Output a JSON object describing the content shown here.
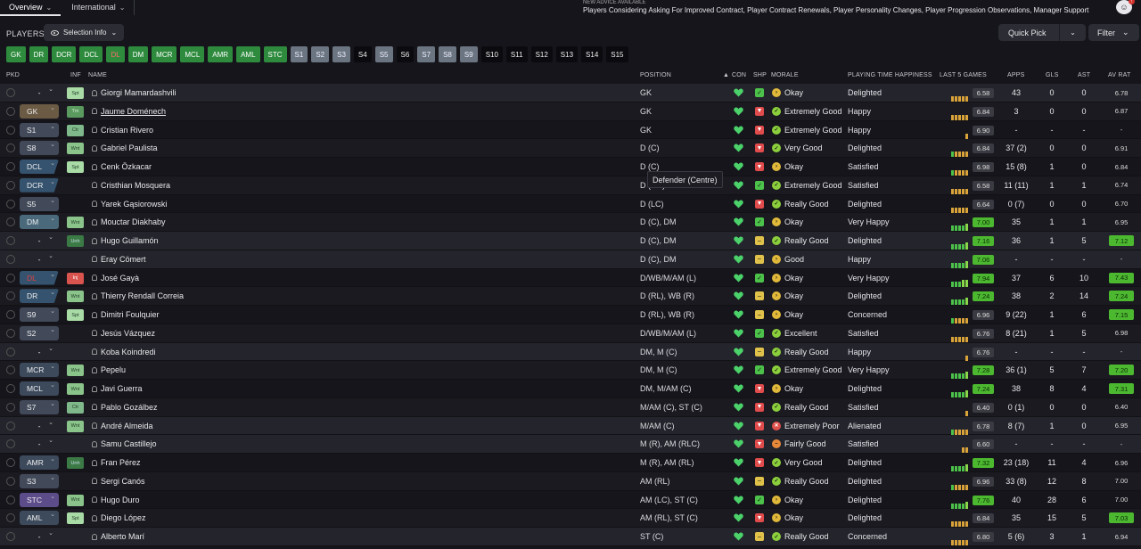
{
  "nav": {
    "tabs": [
      {
        "label": "Overview",
        "active": true
      },
      {
        "label": "International",
        "active": false
      }
    ]
  },
  "advice": {
    "heading": "NEW ADVICE AVAILABLE",
    "text": "Players Considering Asking For Improved Contract, Player Contract Renewals, Player Personality Changes, Player Progression Observations, Manager Support"
  },
  "header": {
    "title": "PLAYERS",
    "selection_info": "Selection Info",
    "quick_pick": "Quick Pick",
    "filter": "Filter"
  },
  "positions": [
    {
      "label": "GK",
      "style": "green"
    },
    {
      "label": "DR",
      "style": "green"
    },
    {
      "label": "DCR",
      "style": "green"
    },
    {
      "label": "DCL",
      "style": "green"
    },
    {
      "label": "DL",
      "style": "green red"
    },
    {
      "label": "DM",
      "style": "green"
    },
    {
      "label": "MCR",
      "style": "green"
    },
    {
      "label": "MCL",
      "style": "green"
    },
    {
      "label": "AMR",
      "style": "green"
    },
    {
      "label": "AML",
      "style": "green"
    },
    {
      "label": "STC",
      "style": "green"
    },
    {
      "label": "S1",
      "style": "grey"
    },
    {
      "label": "S2",
      "style": "grey"
    },
    {
      "label": "S3",
      "style": "grey"
    },
    {
      "label": "S4",
      "style": "black"
    },
    {
      "label": "S5",
      "style": "grey"
    },
    {
      "label": "S6",
      "style": "black"
    },
    {
      "label": "S7",
      "style": "grey"
    },
    {
      "label": "S8",
      "style": "grey"
    },
    {
      "label": "S9",
      "style": "grey"
    },
    {
      "label": "S10",
      "style": "black"
    },
    {
      "label": "S11",
      "style": "black"
    },
    {
      "label": "S12",
      "style": "black"
    },
    {
      "label": "S13",
      "style": "black"
    },
    {
      "label": "S14",
      "style": "black"
    },
    {
      "label": "S15",
      "style": "black"
    }
  ],
  "columns": {
    "pkd": "PKD",
    "inf": "INF",
    "name": "NAME",
    "position": "POSITION",
    "con": "CON",
    "shp": "SHP",
    "morale": "MORALE",
    "pth": "PLAYING TIME HAPPINESS",
    "last5": "LAST 5 GAMES",
    "apps": "APPS",
    "gls": "GLS",
    "ast": "AST",
    "avrat": "AV RAT"
  },
  "players": [
    {
      "pkd": "-",
      "pkd_type": "none",
      "inf": "Spt",
      "name": "Giorgi Mamardashvili",
      "position": "GK",
      "shp": "g",
      "morale": "Okay",
      "mood": "okay",
      "pth": "Delighted",
      "last5": [
        "o",
        "o",
        "o",
        "o",
        "o"
      ],
      "rating": "6.58",
      "apps": "43",
      "gls": "0",
      "ast": "0",
      "avrat": "6.78"
    },
    {
      "pkd": "GK",
      "pkd_type": "gk",
      "inf": "Tm",
      "name": "Jaume Doménech",
      "position": "GK",
      "shp": "r",
      "morale": "Extremely Good",
      "mood": "good",
      "pth": "Happy",
      "last5": [
        "o",
        "o",
        "o",
        "o",
        "o"
      ],
      "rating": "6.84",
      "apps": "3",
      "gls": "0",
      "ast": "0",
      "avrat": "6.87",
      "underline": true
    },
    {
      "pkd": "S1",
      "pkd_type": "sub",
      "inf": "Ctr",
      "name": "Cristian Rivero",
      "position": "GK",
      "shp": "r",
      "morale": "Extremely Good",
      "mood": "good",
      "pth": "Happy",
      "last5": [
        "o"
      ],
      "rating": "6.90",
      "apps": "-",
      "gls": "-",
      "ast": "-",
      "avrat": "-"
    },
    {
      "pkd": "S8",
      "pkd_type": "sub",
      "inf": "Wnt",
      "name": "Gabriel Paulista",
      "position": "D (C)",
      "shp": "r",
      "morale": "Very Good",
      "mood": "good",
      "pth": "Delighted",
      "last5": [
        "g",
        "o",
        "o",
        "o",
        "o"
      ],
      "rating": "6.84",
      "apps": "37 (2)",
      "gls": "0",
      "ast": "0",
      "avrat": "6.91"
    },
    {
      "pkd": "DCL",
      "pkd_type": "def",
      "inf": "Spt",
      "name": "Cenk Özkacar",
      "position": "D (C)",
      "shp": "r",
      "morale": "Okay",
      "mood": "okay",
      "pth": "Satisfied",
      "last5": [
        "g",
        "o",
        "o",
        "o",
        "o"
      ],
      "rating": "6.98",
      "apps": "15 (8)",
      "gls": "1",
      "ast": "0",
      "avrat": "6.84"
    },
    {
      "pkd": "DCR",
      "pkd_type": "def",
      "inf": "",
      "name": "Cristhian Mosquera",
      "position": "D (RC)",
      "shp": "g",
      "morale": "Extremely Good",
      "mood": "good",
      "pth": "Satisfied",
      "last5": [
        "o",
        "o",
        "o",
        "o",
        "o"
      ],
      "rating": "6.58",
      "apps": "11 (11)",
      "gls": "1",
      "ast": "1",
      "avrat": "6.74"
    },
    {
      "pkd": "S5",
      "pkd_type": "sub",
      "inf": "",
      "name": "Yarek Gąsiorowski",
      "position": "D (LC)",
      "shp": "r",
      "morale": "Really Good",
      "mood": "good",
      "pth": "Delighted",
      "last5": [
        "o",
        "o",
        "o",
        "o",
        "o"
      ],
      "rating": "6.64",
      "apps": "0 (7)",
      "gls": "0",
      "ast": "0",
      "avrat": "6.70"
    },
    {
      "pkd": "DM",
      "pkd_type": "dm",
      "inf": "Wnt",
      "name": "Mouctar Diakhaby",
      "position": "D (C), DM",
      "shp": "g",
      "morale": "Okay",
      "mood": "okay",
      "pth": "Very Happy",
      "last5": [
        "g",
        "g",
        "g",
        "g",
        "h"
      ],
      "rating": "7.00",
      "rating_hi": true,
      "apps": "35",
      "gls": "1",
      "ast": "1",
      "avrat": "6.95"
    },
    {
      "pkd": "-",
      "pkd_type": "none",
      "inf": "Unh",
      "name": "Hugo Guillamón",
      "position": "D (C), DM",
      "shp": "y",
      "morale": "Really Good",
      "mood": "good",
      "pth": "Delighted",
      "last5": [
        "g",
        "g",
        "g",
        "g",
        "h"
      ],
      "rating": "7.16",
      "rating_hi": true,
      "apps": "36",
      "gls": "1",
      "ast": "5",
      "avrat": "7.12",
      "avrat_hi": true
    },
    {
      "pkd": "-",
      "pkd_type": "none",
      "inf": "",
      "name": "Eray Cömert",
      "position": "D (C), DM",
      "shp": "y",
      "morale": "Good",
      "mood": "okay",
      "pth": "Happy",
      "last5": [
        "g",
        "g",
        "g",
        "g",
        "h"
      ],
      "rating": "7.06",
      "rating_hi": true,
      "apps": "-",
      "gls": "-",
      "ast": "-",
      "avrat": "-"
    },
    {
      "pkd": "DL",
      "pkd_type": "dl",
      "inf": "Inj",
      "name": "José Gayà",
      "position": "D/WB/M/AM (L)",
      "shp": "g",
      "morale": "Okay",
      "mood": "okay",
      "pth": "Very Happy",
      "last5": [
        "g",
        "g",
        "g",
        "h",
        "h"
      ],
      "rating": "7.94",
      "rating_hi": true,
      "apps": "37",
      "gls": "6",
      "ast": "10",
      "avrat": "7.43",
      "avrat_hi": true
    },
    {
      "pkd": "DR",
      "pkd_type": "def",
      "inf": "Wnt",
      "name": "Thierry Rendall Correia",
      "position": "D (RL), WB (R)",
      "shp": "y",
      "morale": "Okay",
      "mood": "okay",
      "pth": "Delighted",
      "last5": [
        "g",
        "g",
        "g",
        "g",
        "h"
      ],
      "rating": "7.24",
      "rating_hi": true,
      "apps": "38",
      "gls": "2",
      "ast": "14",
      "avrat": "7.24",
      "avrat_hi": true
    },
    {
      "pkd": "S9",
      "pkd_type": "sub",
      "inf": "Spt",
      "name": "Dimitri Foulquier",
      "position": "D (RL), WB (R)",
      "shp": "y",
      "morale": "Okay",
      "mood": "okay",
      "pth": "Concerned",
      "last5": [
        "g",
        "o",
        "o",
        "o",
        "o"
      ],
      "rating": "6.96",
      "apps": "9 (22)",
      "gls": "1",
      "ast": "6",
      "avrat": "7.15",
      "avrat_hi": true
    },
    {
      "pkd": "S2",
      "pkd_type": "sub",
      "inf": "",
      "name": "Jesús Vázquez",
      "position": "D/WB/M/AM (L)",
      "shp": "g",
      "morale": "Excellent",
      "mood": "good",
      "pth": "Satisfied",
      "last5": [
        "o",
        "o",
        "o",
        "o",
        "o"
      ],
      "rating": "6.76",
      "apps": "8 (21)",
      "gls": "1",
      "ast": "5",
      "avrat": "6.98"
    },
    {
      "pkd": "-",
      "pkd_type": "none",
      "inf": "",
      "name": "Koba Koindredi",
      "position": "DM, M (C)",
      "shp": "y",
      "morale": "Really Good",
      "mood": "good",
      "pth": "Happy",
      "last5": [
        "o"
      ],
      "rating": "6.76",
      "apps": "-",
      "gls": "-",
      "ast": "-",
      "avrat": "-"
    },
    {
      "pkd": "MCR",
      "pkd_type": "mid",
      "inf": "Wnt",
      "name": "Pepelu",
      "position": "DM, M (C)",
      "shp": "g",
      "morale": "Extremely Good",
      "mood": "good",
      "pth": "Very Happy",
      "last5": [
        "g",
        "g",
        "g",
        "g",
        "h"
      ],
      "rating": "7.28",
      "rating_hi": true,
      "apps": "36 (1)",
      "gls": "5",
      "ast": "7",
      "avrat": "7.20",
      "avrat_hi": true
    },
    {
      "pkd": "MCL",
      "pkd_type": "mid",
      "inf": "Wnt",
      "name": "Javi Guerra",
      "position": "DM, M/AM (C)",
      "shp": "r",
      "morale": "Okay",
      "mood": "okay",
      "pth": "Delighted",
      "last5": [
        "g",
        "g",
        "g",
        "g",
        "h"
      ],
      "rating": "7.24",
      "rating_hi": true,
      "apps": "38",
      "gls": "8",
      "ast": "4",
      "avrat": "7.31",
      "avrat_hi": true
    },
    {
      "pkd": "S7",
      "pkd_type": "sub",
      "inf": "Ctr",
      "name": "Pablo Gozálbez",
      "position": "M/AM (C), ST (C)",
      "shp": "r",
      "morale": "Really Good",
      "mood": "good",
      "pth": "Satisfied",
      "last5": [
        "o"
      ],
      "rating": "6.40",
      "apps": "0 (1)",
      "gls": "0",
      "ast": "0",
      "avrat": "6.40"
    },
    {
      "pkd": "-",
      "pkd_type": "none",
      "inf": "Wnt",
      "name": "André Almeida",
      "position": "M/AM (C)",
      "shp": "r",
      "morale": "Extremely Poor",
      "mood": "poor",
      "pth": "Alienated",
      "last5": [
        "g",
        "o",
        "o",
        "o",
        "o"
      ],
      "rating": "6.78",
      "apps": "8 (7)",
      "gls": "1",
      "ast": "0",
      "avrat": "6.95"
    },
    {
      "pkd": "-",
      "pkd_type": "none",
      "inf": "",
      "name": "Samu Castillejo",
      "position": "M (R), AM (RLC)",
      "shp": "r",
      "morale": "Fairly Good",
      "mood": "fair",
      "pth": "Satisfied",
      "last5": [
        "o",
        "o"
      ],
      "rating": "6.60",
      "apps": "-",
      "gls": "-",
      "ast": "-",
      "avrat": "-"
    },
    {
      "pkd": "AMR",
      "pkd_type": "mid",
      "inf": "Unh",
      "name": "Fran Pérez",
      "position": "M (R), AM (RL)",
      "shp": "r",
      "morale": "Very Good",
      "mood": "good",
      "pth": "Delighted",
      "last5": [
        "g",
        "g",
        "g",
        "g",
        "h"
      ],
      "rating": "7.32",
      "rating_hi": true,
      "apps": "23 (18)",
      "gls": "11",
      "ast": "4",
      "avrat": "6.96"
    },
    {
      "pkd": "S3",
      "pkd_type": "sub",
      "inf": "",
      "name": "Sergi Canós",
      "position": "AM (RL)",
      "shp": "y",
      "morale": "Really Good",
      "mood": "good",
      "pth": "Delighted",
      "last5": [
        "g",
        "o",
        "o",
        "o",
        "o"
      ],
      "rating": "6.96",
      "apps": "33 (8)",
      "gls": "12",
      "ast": "8",
      "avrat": "7.00"
    },
    {
      "pkd": "STC",
      "pkd_type": "st",
      "inf": "Wnt",
      "name": "Hugo Duro",
      "position": "AM (LC), ST (C)",
      "shp": "g",
      "morale": "Okay",
      "mood": "okay",
      "pth": "Delighted",
      "last5": [
        "g",
        "g",
        "g",
        "g",
        "h"
      ],
      "rating": "7.76",
      "rating_hi": true,
      "apps": "40",
      "gls": "28",
      "ast": "6",
      "avrat": "7.00"
    },
    {
      "pkd": "AML",
      "pkd_type": "mid",
      "inf": "Spt",
      "name": "Diego López",
      "position": "AM (RL), ST (C)",
      "shp": "r",
      "morale": "Okay",
      "mood": "okay",
      "pth": "Delighted",
      "last5": [
        "o",
        "o",
        "o",
        "o",
        "o"
      ],
      "rating": "6.84",
      "apps": "35",
      "gls": "15",
      "ast": "5",
      "avrat": "7.03",
      "avrat_hi": true
    },
    {
      "pkd": "-",
      "pkd_type": "none",
      "inf": "",
      "name": "Alberto Marí",
      "position": "ST (C)",
      "shp": "y",
      "morale": "Really Good",
      "mood": "good",
      "pth": "Concerned",
      "last5": [
        "o",
        "o",
        "o",
        "o",
        "o"
      ],
      "rating": "6.80",
      "apps": "5 (6)",
      "gls": "3",
      "ast": "1",
      "avrat": "6.94"
    }
  ],
  "tooltip": {
    "text": "Defender (Centre)"
  },
  "colors": {
    "background": "#15151b",
    "row_alt": "#24242c",
    "green_chip": "#2e8b3e",
    "grey_chip": "#6b7581",
    "rating_high": "#4cb830",
    "heart": "#4cd26a"
  }
}
